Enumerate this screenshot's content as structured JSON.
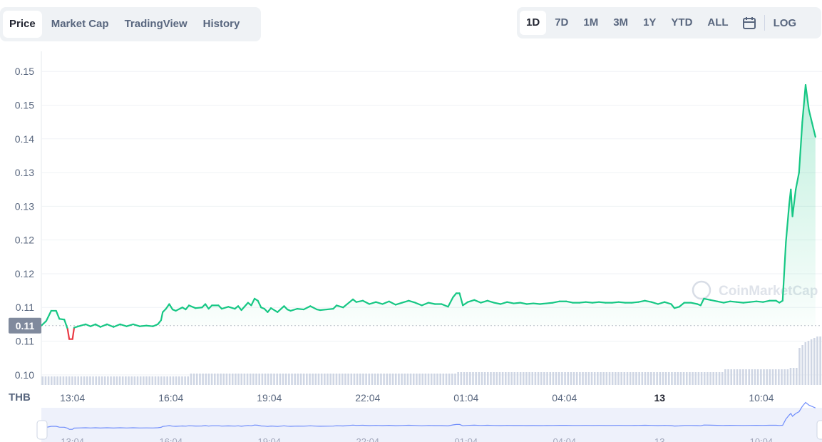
{
  "tabs": [
    {
      "label": "Price",
      "active": true
    },
    {
      "label": "Market Cap",
      "active": false
    },
    {
      "label": "TradingView",
      "active": false
    },
    {
      "label": "History",
      "active": false
    }
  ],
  "ranges": [
    {
      "label": "1D",
      "active": true
    },
    {
      "label": "7D",
      "active": false
    },
    {
      "label": "1M",
      "active": false
    },
    {
      "label": "3M",
      "active": false
    },
    {
      "label": "1Y",
      "active": false
    },
    {
      "label": "YTD",
      "active": false
    },
    {
      "label": "ALL",
      "active": false
    }
  ],
  "calendar_icon": "calendar-icon",
  "log_label": "LOG",
  "currency_label": "THB",
  "watermark": "CoinMarketCap",
  "current_price_label": "0.11",
  "colors": {
    "up": "#16c784",
    "down": "#ea3943",
    "volume": "#cfd6e4",
    "navigator": "#3861fb"
  },
  "chart_data": {
    "type": "line",
    "y_ticks": [
      "0.15",
      "0.15",
      "0.14",
      "0.13",
      "0.13",
      "0.12",
      "0.12",
      "0.11",
      "0.11",
      "0.10"
    ],
    "y_tick_values": [
      0.1515,
      0.1465,
      0.1415,
      0.1365,
      0.1315,
      0.1265,
      0.1215,
      0.1165,
      0.1115,
      0.1065
    ],
    "ylim": [
      0.105,
      0.153
    ],
    "x_ticks": [
      {
        "label": "13:04",
        "t": 0.95,
        "bold": false
      },
      {
        "label": "16:04",
        "t": 3.95,
        "bold": false
      },
      {
        "label": "19:04",
        "t": 6.95,
        "bold": false
      },
      {
        "label": "22:04",
        "t": 9.95,
        "bold": false
      },
      {
        "label": "01:04",
        "t": 12.95,
        "bold": false
      },
      {
        "label": "04:04",
        "t": 15.95,
        "bold": false
      },
      {
        "label": "13",
        "t": 18.85,
        "bold": true
      },
      {
        "label": "10:04",
        "t": 21.95,
        "bold": false
      }
    ],
    "xlim": [
      0,
      23.8
    ],
    "reference_value": 0.1138,
    "series": [
      {
        "values": [
          [
            0.0,
            0.1138
          ],
          [
            0.15,
            0.1145
          ],
          [
            0.3,
            0.116
          ],
          [
            0.45,
            0.116
          ],
          [
            0.55,
            0.1148
          ],
          [
            0.7,
            0.1147
          ],
          [
            0.8,
            0.1133
          ],
          [
            0.85,
            0.1118
          ],
          [
            0.95,
            0.1118
          ],
          [
            1.0,
            0.1135
          ],
          [
            1.2,
            0.1138
          ],
          [
            1.35,
            0.114
          ],
          [
            1.5,
            0.1137
          ],
          [
            1.65,
            0.114
          ],
          [
            1.8,
            0.1136
          ],
          [
            2.0,
            0.114
          ],
          [
            2.2,
            0.1136
          ],
          [
            2.4,
            0.114
          ],
          [
            2.6,
            0.1137
          ],
          [
            2.8,
            0.114
          ],
          [
            3.0,
            0.1137
          ],
          [
            3.2,
            0.1138
          ],
          [
            3.4,
            0.1137
          ],
          [
            3.55,
            0.114
          ],
          [
            3.65,
            0.1146
          ],
          [
            3.7,
            0.1158
          ],
          [
            3.8,
            0.1163
          ],
          [
            3.9,
            0.117
          ],
          [
            4.0,
            0.1162
          ],
          [
            4.1,
            0.116
          ],
          [
            4.3,
            0.1165
          ],
          [
            4.4,
            0.1162
          ],
          [
            4.5,
            0.1168
          ],
          [
            4.7,
            0.1164
          ],
          [
            4.9,
            0.1165
          ],
          [
            5.0,
            0.117
          ],
          [
            5.1,
            0.1163
          ],
          [
            5.2,
            0.1168
          ],
          [
            5.4,
            0.1168
          ],
          [
            5.5,
            0.1163
          ],
          [
            5.7,
            0.1166
          ],
          [
            5.9,
            0.1163
          ],
          [
            6.0,
            0.1167
          ],
          [
            6.1,
            0.1161
          ],
          [
            6.3,
            0.1172
          ],
          [
            6.4,
            0.1168
          ],
          [
            6.5,
            0.1178
          ],
          [
            6.6,
            0.1175
          ],
          [
            6.7,
            0.1165
          ],
          [
            6.8,
            0.1163
          ],
          [
            6.9,
            0.1158
          ],
          [
            7.0,
            0.1164
          ],
          [
            7.2,
            0.1158
          ],
          [
            7.4,
            0.1167
          ],
          [
            7.5,
            0.1162
          ],
          [
            7.6,
            0.116
          ],
          [
            7.8,
            0.1163
          ],
          [
            8.0,
            0.1162
          ],
          [
            8.2,
            0.1167
          ],
          [
            8.4,
            0.1162
          ],
          [
            8.5,
            0.1161
          ],
          [
            8.7,
            0.1162
          ],
          [
            8.9,
            0.1163
          ],
          [
            9.0,
            0.1168
          ],
          [
            9.2,
            0.1165
          ],
          [
            9.4,
            0.1173
          ],
          [
            9.5,
            0.1177
          ],
          [
            9.6,
            0.1173
          ],
          [
            9.8,
            0.1175
          ],
          [
            10.0,
            0.117
          ],
          [
            10.2,
            0.1173
          ],
          [
            10.4,
            0.117
          ],
          [
            10.6,
            0.1174
          ],
          [
            10.8,
            0.1169
          ],
          [
            11.0,
            0.1172
          ],
          [
            11.2,
            0.1175
          ],
          [
            11.4,
            0.1172
          ],
          [
            11.6,
            0.1168
          ],
          [
            11.8,
            0.1172
          ],
          [
            12.0,
            0.117
          ],
          [
            12.2,
            0.117
          ],
          [
            12.4,
            0.1166
          ],
          [
            12.55,
            0.118
          ],
          [
            12.65,
            0.1186
          ],
          [
            12.75,
            0.1186
          ],
          [
            12.85,
            0.1168
          ],
          [
            13.0,
            0.1173
          ],
          [
            13.2,
            0.1176
          ],
          [
            13.4,
            0.1172
          ],
          [
            13.6,
            0.1175
          ],
          [
            13.8,
            0.1172
          ],
          [
            14.0,
            0.117
          ],
          [
            14.2,
            0.1173
          ],
          [
            14.4,
            0.1171
          ],
          [
            14.6,
            0.1172
          ],
          [
            14.8,
            0.117
          ],
          [
            15.0,
            0.1171
          ],
          [
            15.2,
            0.117
          ],
          [
            15.4,
            0.1171
          ],
          [
            15.6,
            0.1172
          ],
          [
            15.8,
            0.1174
          ],
          [
            16.0,
            0.1174
          ],
          [
            16.2,
            0.1172
          ],
          [
            16.4,
            0.1172
          ],
          [
            16.6,
            0.1173
          ],
          [
            16.8,
            0.1172
          ],
          [
            17.0,
            0.1173
          ],
          [
            17.2,
            0.1172
          ],
          [
            17.4,
            0.1172
          ],
          [
            17.6,
            0.1173
          ],
          [
            17.8,
            0.1172
          ],
          [
            18.0,
            0.1172
          ],
          [
            18.2,
            0.1173
          ],
          [
            18.4,
            0.1175
          ],
          [
            18.6,
            0.1173
          ],
          [
            18.8,
            0.117
          ],
          [
            19.0,
            0.1173
          ],
          [
            19.2,
            0.117
          ],
          [
            19.3,
            0.1164
          ],
          [
            19.45,
            0.1166
          ],
          [
            19.6,
            0.1172
          ],
          [
            19.8,
            0.1172
          ],
          [
            20.0,
            0.117
          ],
          [
            20.1,
            0.1168
          ],
          [
            20.2,
            0.1178
          ],
          [
            20.4,
            0.1176
          ],
          [
            20.6,
            0.1174
          ],
          [
            20.8,
            0.1172
          ],
          [
            21.0,
            0.1174
          ],
          [
            21.2,
            0.1173
          ],
          [
            21.4,
            0.1172
          ],
          [
            21.6,
            0.1173
          ],
          [
            21.8,
            0.1174
          ],
          [
            22.0,
            0.1173
          ],
          [
            22.2,
            0.1175
          ],
          [
            22.4,
            0.1175
          ],
          [
            22.5,
            0.1172
          ],
          [
            22.6,
            0.1175
          ],
          [
            22.7,
            0.1262
          ],
          [
            22.8,
            0.1318
          ],
          [
            22.85,
            0.134
          ],
          [
            22.9,
            0.13
          ],
          [
            23.0,
            0.134
          ],
          [
            23.1,
            0.1365
          ],
          [
            23.2,
            0.144
          ],
          [
            23.3,
            0.1495
          ],
          [
            23.4,
            0.1458
          ],
          [
            23.5,
            0.1438
          ],
          [
            23.6,
            0.1418
          ]
        ]
      }
    ],
    "volume": [
      0.6,
      0.6,
      0.6,
      0.6,
      0.6,
      0.6,
      0.6,
      0.6,
      0.6,
      0.6,
      0.6,
      0.6,
      0.6,
      0.6,
      0.6,
      0.6,
      0.6,
      0.6,
      0.6,
      0.6,
      0.6,
      0.6,
      0.6,
      0.6,
      0.6,
      0.6,
      0.6,
      0.6,
      0.6,
      0.6,
      0.6,
      0.6,
      0.6,
      0.6,
      0.6,
      0.6,
      0.6,
      0.6,
      0.6,
      0.6,
      0.6,
      0.6,
      0.6,
      0.6,
      0.6,
      0.6,
      0.6,
      0.6,
      0.6,
      0.6,
      0.8,
      0.8,
      0.8,
      0.8,
      0.8,
      0.8,
      0.8,
      0.8,
      0.8,
      0.8,
      0.8,
      0.8,
      0.8,
      0.8,
      0.8,
      0.8,
      0.8,
      0.8,
      0.8,
      0.8,
      0.8,
      0.8,
      0.8,
      0.8,
      0.8,
      0.8,
      0.8,
      0.8,
      0.8,
      0.8,
      0.8,
      0.8,
      0.8,
      0.8,
      0.8,
      0.8,
      0.8,
      0.8,
      0.8,
      0.8,
      0.8,
      0.8,
      0.8,
      0.8,
      0.8,
      0.8,
      0.8,
      0.8,
      0.8,
      0.8,
      0.8,
      0.8,
      0.8,
      0.8,
      0.8,
      0.8,
      0.8,
      0.8,
      0.8,
      0.8,
      0.8,
      0.8,
      0.8,
      0.8,
      0.8,
      0.8,
      0.8,
      0.8,
      0.8,
      0.8,
      0.8,
      0.8,
      0.8,
      0.8,
      0.8,
      0.8,
      0.8,
      0.8,
      0.8,
      0.8,
      0.8,
      0.8,
      0.8,
      0.8,
      0.8,
      0.8,
      0.8,
      0.8,
      0.8,
      0.8,
      0.9,
      0.9,
      0.9,
      0.9,
      0.9,
      0.9,
      0.9,
      0.9,
      0.9,
      0.9,
      0.9,
      0.9,
      0.9,
      0.9,
      0.9,
      0.9,
      0.9,
      0.9,
      0.9,
      0.9,
      0.9,
      0.9,
      0.9,
      0.9,
      0.9,
      0.9,
      0.9,
      0.9,
      0.9,
      0.9,
      0.9,
      0.9,
      0.9,
      0.9,
      0.9,
      0.9,
      0.9,
      0.9,
      0.9,
      0.9,
      0.9,
      0.9,
      0.9,
      0.9,
      0.9,
      0.9,
      0.9,
      0.9,
      0.9,
      0.9,
      0.9,
      0.9,
      0.9,
      0.9,
      0.9,
      0.9,
      0.9,
      0.9,
      0.9,
      0.9,
      0.9,
      0.9,
      0.9,
      0.9,
      0.9,
      0.9,
      0.9,
      0.9,
      0.9,
      0.9,
      0.9,
      0.9,
      0.9,
      0.9,
      0.9,
      0.9,
      0.9,
      0.9,
      0.9,
      0.9,
      0.9,
      0.9,
      0.9,
      0.9,
      0.9,
      0.9,
      0.9,
      0.9,
      0.9,
      0.9,
      1.1,
      1.1,
      1.1,
      1.1,
      1.1,
      1.1,
      1.1,
      1.1,
      1.1,
      1.1,
      1.1,
      1.1,
      1.1,
      1.1,
      1.1,
      1.1,
      1.1,
      1.1,
      1.1,
      1.1,
      1.1,
      1.1,
      1.2,
      1.2,
      1.2,
      2.6,
      2.8,
      3.0,
      3.1,
      3.2,
      3.3,
      3.4,
      3.4
    ],
    "grid": true,
    "legend": "none"
  }
}
